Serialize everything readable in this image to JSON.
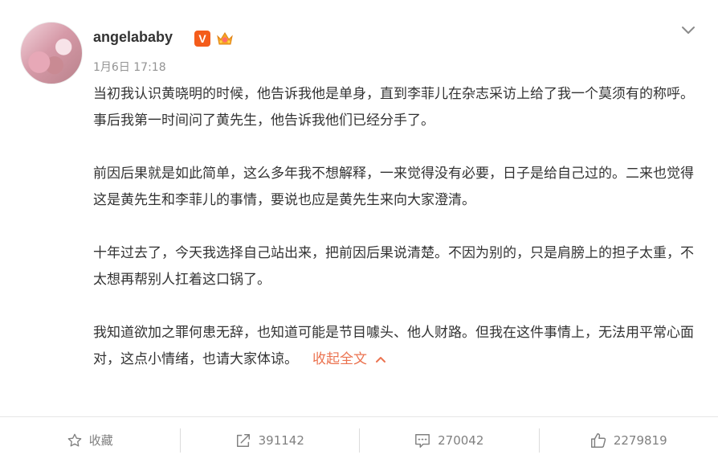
{
  "post": {
    "username": "angelababy",
    "verified_badge": "V",
    "timestamp": "1月6日 17:18",
    "paragraphs": [
      "当初我认识黄晓明的时候，他告诉我他是单身，直到李菲儿在杂志采访上给了我一个莫须有的称呼。事后我第一时间问了黄先生，他告诉我他们已经分手了。",
      "前因后果就是如此简单，这么多年我不想解释，一来觉得没有必要，日子是给自己过的。二来也觉得这是黄先生和李菲儿的事情，要说也应是黄先生来向大家澄清。",
      "十年过去了，今天我选择自己站出来，把前因后果说清楚。不因为别的，只是肩膀上的担子太重，不太想再帮别人扛着这口锅了。",
      "我知道欲加之罪何患无辞，也知道可能是节目噱头、他人财路。但我在这件事情上，无法用平常心面对，这点小情绪，也请大家体谅。"
    ],
    "collapse_label": "收起全文",
    "link_color": "#eb7350",
    "verified_color": "#f45c1b"
  },
  "actions": {
    "favorite_label": "收藏",
    "repost_count": "391142",
    "comment_count": "270042",
    "like_count": "2279819"
  },
  "icons": {
    "favorite": "star-outline-icon",
    "repost": "share-arrow-icon",
    "comment": "comment-bubble-icon",
    "like": "thumbs-up-icon",
    "menu": "chevron-down-icon"
  }
}
